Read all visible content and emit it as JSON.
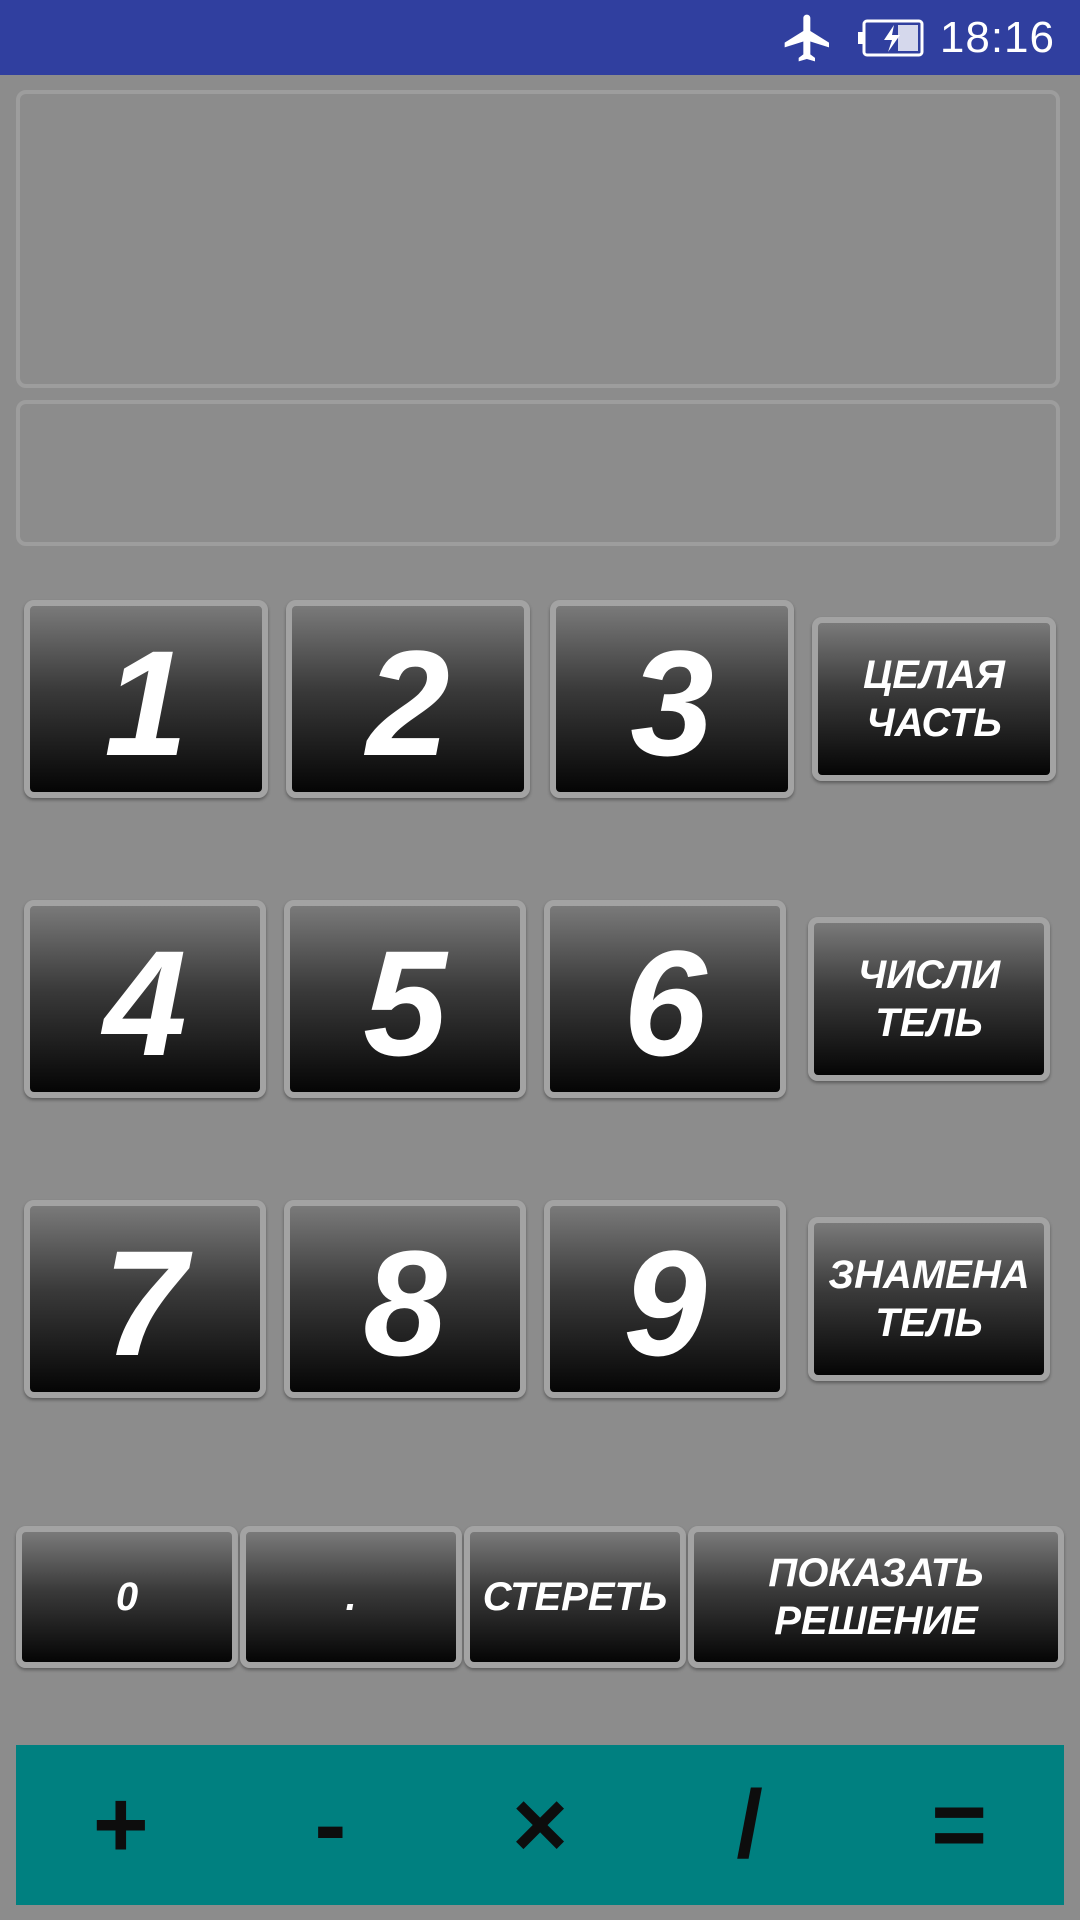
{
  "status_bar": {
    "time": "18:16",
    "icons": [
      "airplane-mode-icon",
      "battery-charging-icon"
    ],
    "color": "#303f9f"
  },
  "display": {
    "main_value": "",
    "secondary_value": ""
  },
  "keypad": {
    "rows": [
      [
        "1",
        "2",
        "3"
      ],
      [
        "4",
        "5",
        "6"
      ],
      [
        "7",
        "8",
        "9"
      ]
    ],
    "mode_buttons": [
      "ЦЕЛАЯ\nЧАСТЬ",
      "ЧИСЛИ\nТЕЛЬ",
      "ЗНАМЕНА\nТЕЛЬ"
    ],
    "bottom_row": {
      "zero": "0",
      "dot": ".",
      "clear": "СТЕРЕТЬ",
      "show_solution": "ПОКАЗАТЬ\nРЕШЕНИЕ"
    }
  },
  "operators": {
    "plus": "+",
    "minus": "-",
    "multiply": "×",
    "divide": "/",
    "equals": "=",
    "bar_color": "#008080"
  }
}
